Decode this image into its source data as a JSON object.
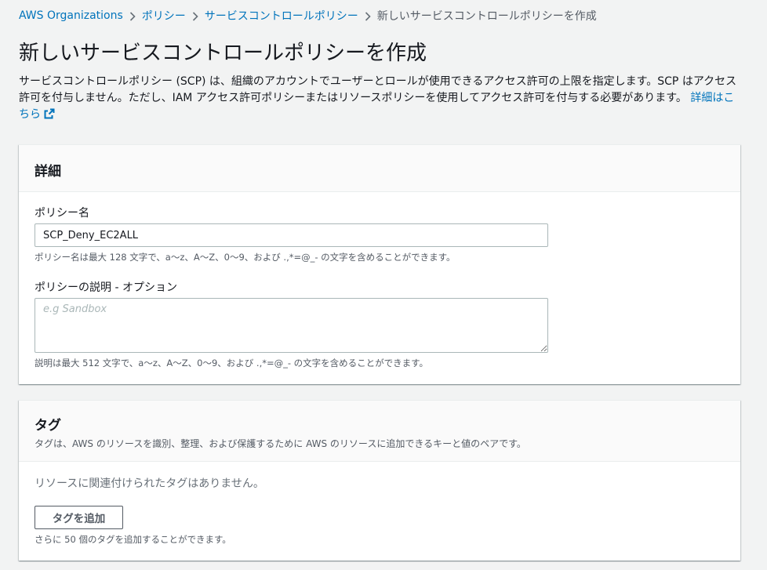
{
  "breadcrumb": {
    "items": [
      "AWS Organizations",
      "ポリシー",
      "サービスコントロールポリシー"
    ],
    "current": "新しいサービスコントロールポリシーを作成"
  },
  "header": {
    "title": "新しいサービスコントロールポリシーを作成",
    "description": "サービスコントロールポリシー (SCP) は、組織のアカウントでユーザーとロールが使用できるアクセス許可の上限を指定します。SCP はアクセス許可を付与しません。ただし、IAM アクセス許可ポリシーまたはリソースポリシーを使用してアクセス許可を付与する必要があります。",
    "learn_more": "詳細はこちら"
  },
  "details": {
    "title": "詳細",
    "name_label": "ポリシー名",
    "name_value": "SCP_Deny_EC2ALL",
    "name_hint": "ポリシー名は最大 128 文字で、a〜z、A〜Z、0〜9、および .,*=@_- の文字を含めることができます。",
    "desc_label": "ポリシーの説明 - オプション",
    "desc_placeholder": "e.g Sandbox",
    "desc_hint": "説明は最大 512 文字で、a〜z、A〜Z、0〜9、および .,*=@_- の文字を含めることができます。"
  },
  "tags": {
    "title": "タグ",
    "subtitle": "タグは、AWS のリソースを識別、整理、および保護するために AWS のリソースに追加できるキーと値のペアです。",
    "empty": "リソースに関連付けられたタグはありません。",
    "add_button": "タグを追加",
    "limit_hint": "さらに 50 個のタグを追加することができます。"
  },
  "colors": {
    "link": "#0073bb",
    "background": "#f2f3f3",
    "panel": "#ffffff"
  }
}
